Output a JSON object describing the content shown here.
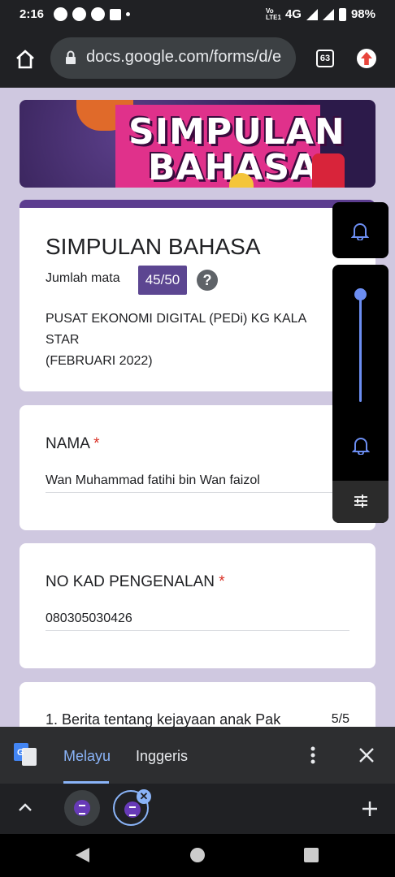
{
  "status_bar": {
    "time": "2:16",
    "network": "4G",
    "volte": "Vo LTE1",
    "battery": "98%"
  },
  "browser": {
    "url": "docs.google.com/forms/d/e",
    "tab_count": "63"
  },
  "form": {
    "title": "SIMPULAN BAHASA",
    "banner_line1": "SIMPULAN",
    "banner_line2": "BAHASA",
    "score_label": "Jumlah mata",
    "score": "45/50",
    "help": "?",
    "description_line1": "PUSAT EKONOMI DIGITAL (PEDi) KG KALA STAR",
    "description_line2": "(FEBRUARI 2022)"
  },
  "questions": {
    "nama_label": "NAMA",
    "nama_value": "Wan Muhammad fatihi bin Wan faizol",
    "nokp_label": "NO KAD PENGENALAN",
    "nokp_value": "080305030426",
    "required_mark": "*",
    "q1_text": "1. Berita tentang kejayaan anak Pak",
    "q1_score": "5/5"
  },
  "translate": {
    "source_lang": "Melayu",
    "target_lang": "Inggeris"
  },
  "tab_strip": {
    "close_glyph": "✕"
  },
  "colors": {
    "accent": "#5c3d8f",
    "badge": "#5c4691",
    "required": "#d93025",
    "volume_accent": "#6c8ef2",
    "translate_active": "#8ab4f8"
  }
}
